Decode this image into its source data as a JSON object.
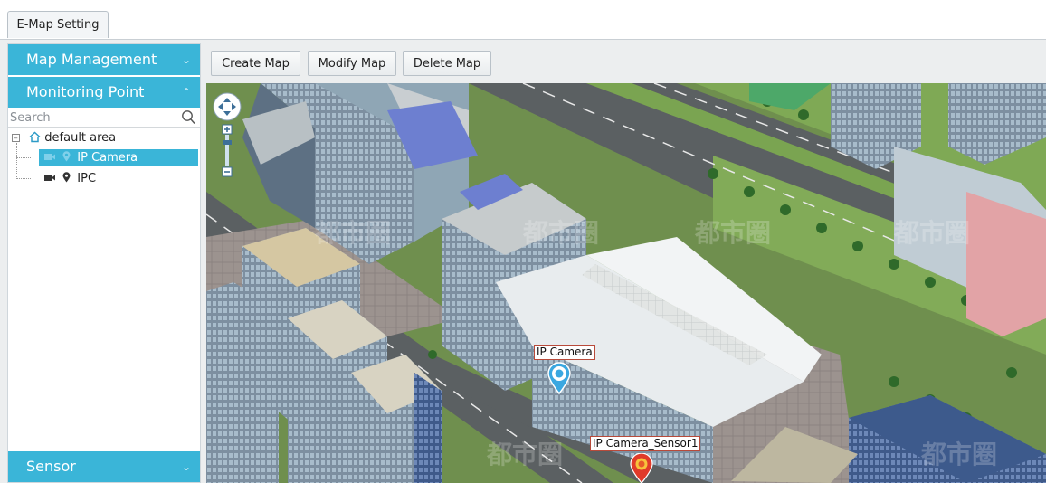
{
  "tabs": [
    {
      "label": "E-Map Setting"
    }
  ],
  "sidebar": {
    "sections": [
      {
        "label": "Map Management",
        "expanded": false
      },
      {
        "label": "Monitoring Point",
        "expanded": true
      },
      {
        "label": "Sensor",
        "expanded": false
      }
    ],
    "search": {
      "placeholder": "Search",
      "value": ""
    },
    "tree": {
      "root": {
        "label": "default area",
        "expanded": true
      },
      "children": [
        {
          "label": "IP Camera",
          "selected": true
        },
        {
          "label": "IPC",
          "selected": false
        }
      ]
    }
  },
  "toolbar": {
    "create_label": "Create Map",
    "modify_label": "Modify Map",
    "delete_label": "Delete Map"
  },
  "map": {
    "markers": [
      {
        "label": "IP Camera",
        "type": "camera",
        "color": "#3aa7e0"
      },
      {
        "label": "IP Camera_Sensor1",
        "type": "sensor",
        "color": "#e03a2a"
      }
    ],
    "watermark": "都市圈"
  },
  "colors": {
    "accent": "#3ab5d8",
    "panel_bg": "#eceeef"
  }
}
